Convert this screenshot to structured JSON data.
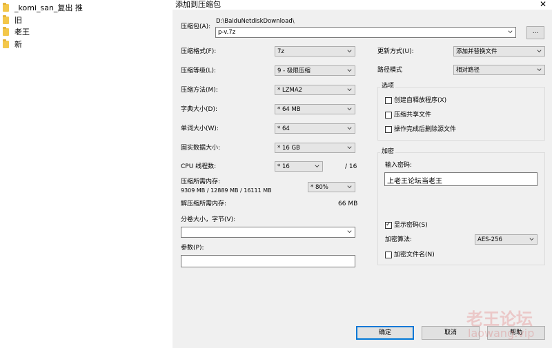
{
  "explorer": {
    "folders": [
      "_komi_san_复出 推",
      "旧",
      "老王",
      "新"
    ]
  },
  "dialog": {
    "title": "添加到压缩包",
    "archive": {
      "label": "压缩包(A):",
      "path": "D:\\BaiduNetdiskDownload\\",
      "name": "p-v.7z",
      "browse": "..."
    },
    "format": {
      "label": "压缩格式(F):",
      "value": "7z"
    },
    "level": {
      "label": "压缩等级(L):",
      "value": "9 - 极限压缩"
    },
    "method": {
      "label": "压缩方法(M):",
      "value": "* LZMA2"
    },
    "dict": {
      "label": "字典大小(D):",
      "value": "* 64 MB"
    },
    "word": {
      "label": "单词大小(W):",
      "value": "* 64"
    },
    "solid": {
      "label": "固实数据大小:",
      "value": "* 16 GB"
    },
    "cpu": {
      "label": "CPU 线程数:",
      "value": "* 16",
      "max": "/ 16"
    },
    "mem_compress": {
      "label": "压缩所需内存:",
      "detail": "9309 MB / 12889 MB / 16111 MB",
      "value": "* 80%"
    },
    "mem_decompress": {
      "label": "解压缩所需内存:",
      "value": "66 MB"
    },
    "split": {
      "label": "分卷大小，字节(V):",
      "value": ""
    },
    "params": {
      "label": "参数(P):",
      "value": ""
    },
    "update": {
      "label": "更新方式(U):",
      "value": "添加并替换文件"
    },
    "pathmode": {
      "label": "路径模式",
      "value": "相对路径"
    },
    "options": {
      "label": "选项",
      "sfx": {
        "label": "创建自释放程序(X)",
        "checked": false
      },
      "shared": {
        "label": "压缩共享文件",
        "checked": false
      },
      "delete": {
        "label": "操作完成后删除源文件",
        "checked": false
      }
    },
    "encryption": {
      "label": "加密",
      "pwd_label": "输入密码:",
      "pwd_value": "上老王论坛当老王",
      "show": {
        "label": "显示密码(S)",
        "checked": true
      },
      "algo_label": "加密算法:",
      "algo_value": "AES-256",
      "names": {
        "label": "加密文件名(N)",
        "checked": false
      }
    },
    "buttons": {
      "ok": "确定",
      "cancel": "取消",
      "help": "帮助"
    }
  },
  "watermark": {
    "cn": "老王论坛",
    "en": "laowang.vip"
  }
}
